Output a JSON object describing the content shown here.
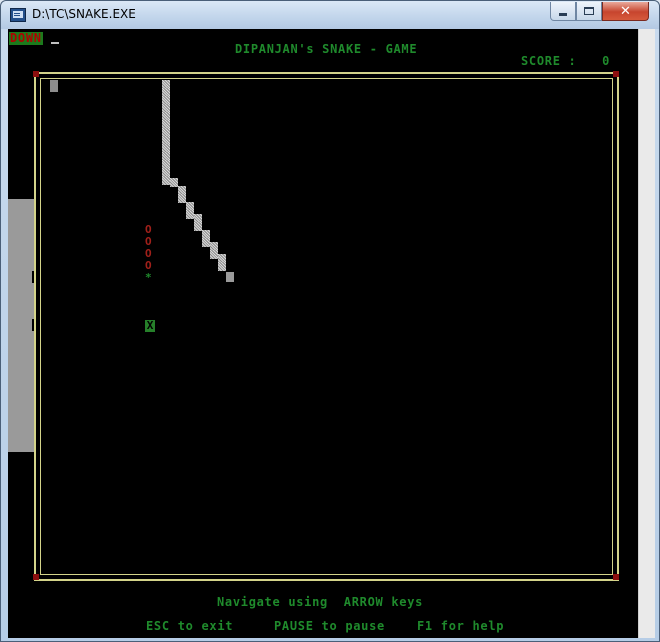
{
  "window": {
    "title": "D:\\TC\\SNAKE.EXE",
    "close_glyph": "✕"
  },
  "game": {
    "direction": "DOWN",
    "title": "DIPANJAN's SNAKE - GAME",
    "score_label": "SCORE :",
    "score_value": "0",
    "food_char": "X",
    "trail_char": "O",
    "marker_char": "*"
  },
  "help": {
    "navigate": "Navigate using  ARROW keys",
    "esc": "ESC to exit",
    "pause": "PAUSE to pause",
    "f1": "F1 for help"
  },
  "colors": {
    "console_bg": "#000000",
    "text_green": "#1f8a2c",
    "frame_yellow": "#d4d48a",
    "corner_red": "#8c0f0f",
    "snake_gray": "#b8b8b8",
    "direction_red": "#b10000"
  }
}
